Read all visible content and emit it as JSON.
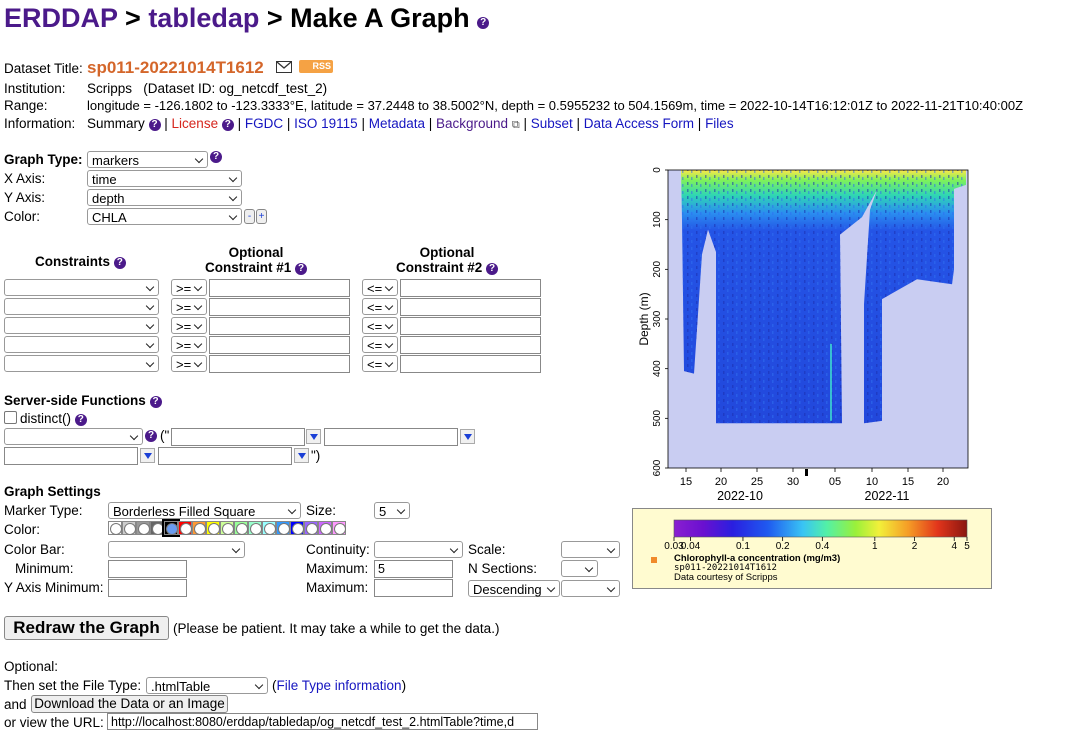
{
  "header": {
    "crumb1": "ERDDAP",
    "sep1": " > ",
    "crumb2": "tabledap",
    "sep2": " > ",
    "title": "Make A Graph"
  },
  "info": {
    "dataset_title_label": "Dataset Title:",
    "dataset_title": "sp011-20221014T1612",
    "rss": "RSS",
    "institution_label": "Institution:",
    "institution": "Scripps",
    "dataset_id": "(Dataset ID: og_netcdf_test_2)",
    "range_label": "Range:",
    "range": "longitude = -126.1802 to -123.3333°E, latitude = 37.2448 to 38.5002°N, depth = 0.5955232 to 504.1569m, time = 2022-10-14T16:12:01Z to 2022-11-21T10:40:00Z",
    "information_label": "Information:",
    "links": {
      "summary": "Summary",
      "license": "License",
      "fgdc": "FGDC",
      "iso": "ISO 19115",
      "metadata": "Metadata",
      "background": "Background",
      "subset": "Subset",
      "data_access": "Data Access Form",
      "files": "Files"
    }
  },
  "graph": {
    "graph_type_label": "Graph Type:",
    "graph_type": "markers",
    "x_axis_label": "X Axis:",
    "x_axis": "time",
    "y_axis_label": "Y Axis:",
    "y_axis": "depth",
    "color_label": "Color:",
    "color": "CHLA",
    "minus": "-",
    "plus": "+"
  },
  "constraints": {
    "header": "Constraints",
    "opt1_line1": "Optional",
    "opt1_line2": "Constraint #1",
    "opt2_line1": "Optional",
    "opt2_line2": "Constraint #2",
    "op1": ">=",
    "op2": "<="
  },
  "server": {
    "title": "Server-side Functions",
    "distinct": "distinct()",
    "open": "(\"",
    "close": "\")"
  },
  "settings": {
    "title": "Graph Settings",
    "marker_type_label": "Marker Type:",
    "marker_type": "Borderless Filled Square",
    "size_label": "Size:",
    "size": "5",
    "color_label": "Color:",
    "color_bar_label": "Color Bar:",
    "continuity_label": "Continuity:",
    "scale_label": "Scale:",
    "minimum_label": "Minimum:",
    "maximum_label": "Maximum:",
    "maximum_value": "5",
    "n_sections_label": "N Sections:",
    "y_min_label": "Y Axis Minimum:",
    "y_max_label": "Maximum:",
    "order": "Descending",
    "swatch_colors": [
      "#ffffff",
      "#cccccc",
      "#999999",
      "#666666",
      "#000000",
      "#ff0000",
      "#ff9933",
      "#ffff00",
      "#ccff99",
      "#99ff99",
      "#99ffcc",
      "#99ffff",
      "#3399ff",
      "#0000ff",
      "#9966ff",
      "#cc66ff",
      "#ff99ff"
    ]
  },
  "redraw": {
    "button": "Redraw the Graph",
    "note": "(Please be patient. It may take a while to get the data.)"
  },
  "optional": {
    "label": "Optional:",
    "file_type_prefix": "Then set the File Type:",
    "file_type": ".htmlTable",
    "file_type_info": "File Type information",
    "and": "and",
    "download_button": "Download the Data or an Image",
    "url_prefix": "or view the URL:",
    "url": "http://localhost:8080/erddap/tabledap/og_netcdf_test_2.htmlTable?time,d"
  },
  "chart_data": {
    "type": "scatter",
    "ylabel": "Depth (m)",
    "y_ticks": [
      "0",
      "100",
      "200",
      "300",
      "400",
      "500",
      "600"
    ],
    "ylim": [
      600,
      0
    ],
    "x_ticks": [
      "15",
      "20",
      "25",
      "30",
      "05",
      "10",
      "15",
      "20"
    ],
    "x_month_labels": [
      "2022-10",
      "2022-11"
    ],
    "legend": {
      "title": "Chlorophyll-a concentration (mg/m3)",
      "dataset": "sp011-20221014T1612",
      "credit": "Data courtesy of Scripps",
      "ticks": [
        "0.03",
        "0.04",
        "0.1",
        "0.2",
        "0.4",
        "1",
        "2",
        "4",
        "5"
      ],
      "scale": "log"
    }
  }
}
